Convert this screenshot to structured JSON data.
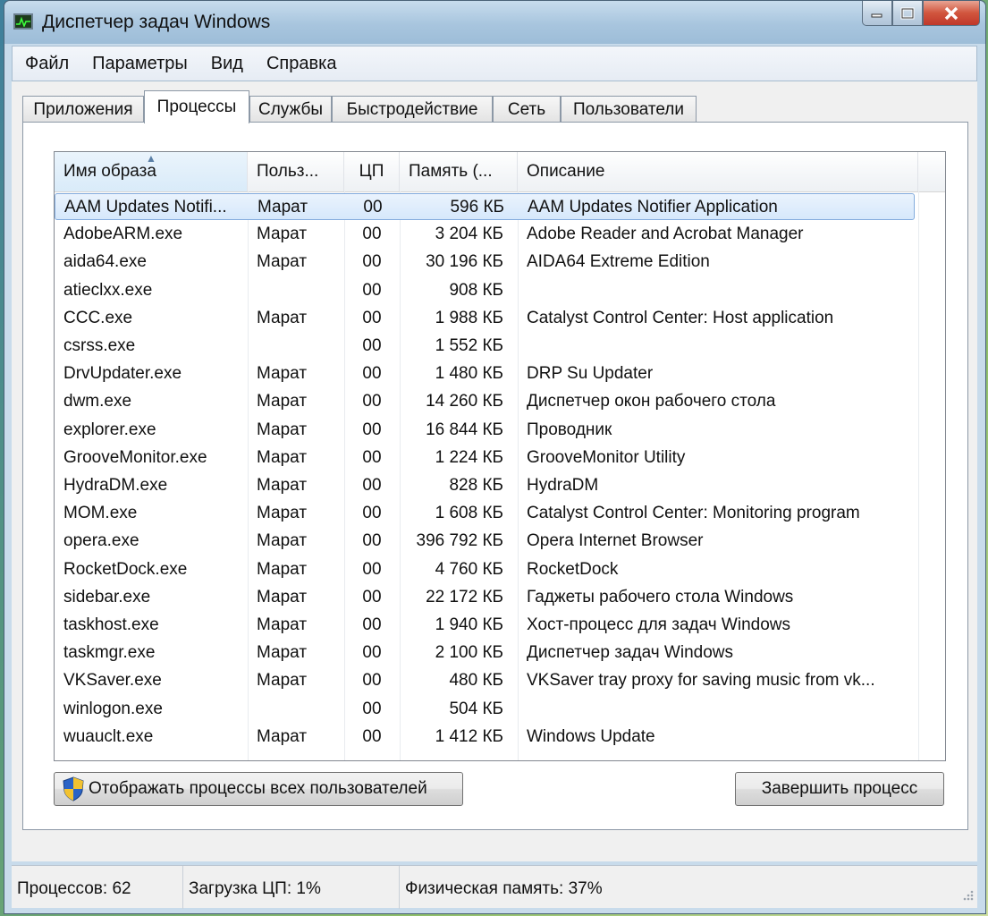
{
  "window": {
    "title": "Диспетчер задач Windows",
    "icon": "task-manager-icon"
  },
  "menu": [
    "Файл",
    "Параметры",
    "Вид",
    "Справка"
  ],
  "tabs": [
    "Приложения",
    "Процессы",
    "Службы",
    "Быстродействие",
    "Сеть",
    "Пользователи"
  ],
  "active_tab": "Процессы",
  "columns": {
    "name": "Имя образа",
    "user": "Польз...",
    "cpu": "ЦП",
    "memory": "Память (...",
    "description": "Описание"
  },
  "processes": [
    {
      "name": "AAM Updates Notifi...",
      "user": "Марат",
      "cpu": "00",
      "memory": "596 КБ",
      "description": "AAM Updates Notifier Application",
      "selected": true
    },
    {
      "name": "AdobeARM.exe",
      "user": "Марат",
      "cpu": "00",
      "memory": "3 204 КБ",
      "description": "Adobe Reader and Acrobat Manager"
    },
    {
      "name": "aida64.exe",
      "user": "Марат",
      "cpu": "00",
      "memory": "30 196 КБ",
      "description": "AIDA64 Extreme Edition"
    },
    {
      "name": "atieclxx.exe",
      "user": "",
      "cpu": "00",
      "memory": "908 КБ",
      "description": ""
    },
    {
      "name": "CCC.exe",
      "user": "Марат",
      "cpu": "00",
      "memory": "1 988 КБ",
      "description": "Catalyst Control Center: Host application"
    },
    {
      "name": "csrss.exe",
      "user": "",
      "cpu": "00",
      "memory": "1 552 КБ",
      "description": ""
    },
    {
      "name": "DrvUpdater.exe",
      "user": "Марат",
      "cpu": "00",
      "memory": "1 480 КБ",
      "description": "DRP Su Updater"
    },
    {
      "name": "dwm.exe",
      "user": "Марат",
      "cpu": "00",
      "memory": "14 260 КБ",
      "description": "Диспетчер окон рабочего стола"
    },
    {
      "name": "explorer.exe",
      "user": "Марат",
      "cpu": "00",
      "memory": "16 844 КБ",
      "description": "Проводник"
    },
    {
      "name": "GrooveMonitor.exe",
      "user": "Марат",
      "cpu": "00",
      "memory": "1 224 КБ",
      "description": "GrooveMonitor Utility"
    },
    {
      "name": "HydraDM.exe",
      "user": "Марат",
      "cpu": "00",
      "memory": "828 КБ",
      "description": "HydraDM"
    },
    {
      "name": "MOM.exe",
      "user": "Марат",
      "cpu": "00",
      "memory": "1 608 КБ",
      "description": "Catalyst Control Center: Monitoring program"
    },
    {
      "name": "opera.exe",
      "user": "Марат",
      "cpu": "00",
      "memory": "396 792 КБ",
      "description": "Opera Internet Browser"
    },
    {
      "name": "RocketDock.exe",
      "user": "Марат",
      "cpu": "00",
      "memory": "4 760 КБ",
      "description": "RocketDock"
    },
    {
      "name": "sidebar.exe",
      "user": "Марат",
      "cpu": "00",
      "memory": "22 172 КБ",
      "description": "Гаджеты рабочего стола Windows"
    },
    {
      "name": "taskhost.exe",
      "user": "Марат",
      "cpu": "00",
      "memory": "1 940 КБ",
      "description": "Хост-процесс для задач Windows"
    },
    {
      "name": "taskmgr.exe",
      "user": "Марат",
      "cpu": "00",
      "memory": "2 100 КБ",
      "description": "Диспетчер задач Windows"
    },
    {
      "name": "VKSaver.exe",
      "user": "Марат",
      "cpu": "00",
      "memory": "480 КБ",
      "description": "VKSaver tray proxy for saving music from vk..."
    },
    {
      "name": "winlogon.exe",
      "user": "",
      "cpu": "00",
      "memory": "504 КБ",
      "description": ""
    },
    {
      "name": "wuauclt.exe",
      "user": "Марат",
      "cpu": "00",
      "memory": "1 412 КБ",
      "description": "Windows Update"
    }
  ],
  "buttons": {
    "show_all_label": "Отображать процессы всех пользователей",
    "end_process_label": "Завершить процесс"
  },
  "status": {
    "processes": "Процессов: 62",
    "cpu": "Загрузка ЦП: 1%",
    "memory": "Физическая память: 37%"
  },
  "colors": {
    "selection": "#d6e8fb",
    "selection_border": "#84acdd",
    "close_button": "#c0392b"
  }
}
